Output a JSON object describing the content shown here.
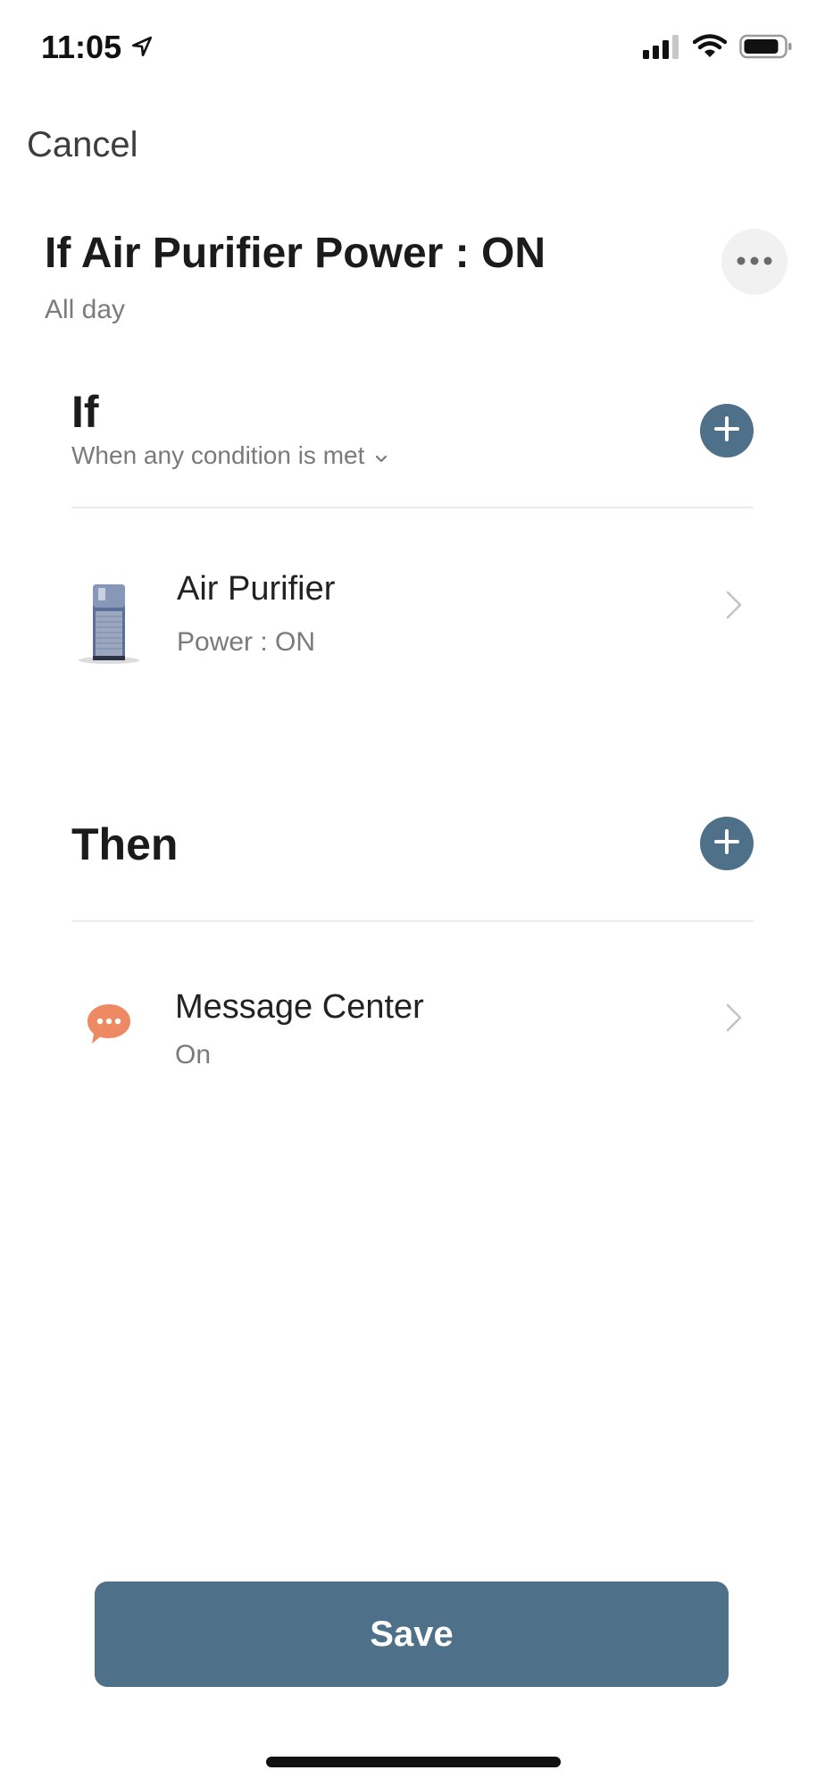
{
  "status_bar": {
    "time": "11:05",
    "icons": [
      "location-arrow-icon",
      "cellular-signal-icon",
      "wifi-icon",
      "battery-icon"
    ]
  },
  "nav": {
    "cancel_label": "Cancel"
  },
  "scene": {
    "title": "If Air Purifier Power : ON",
    "schedule": "All day",
    "more_icon": "more-horizontal-icon"
  },
  "if_section": {
    "title": "If",
    "condition_mode": "When any condition is met",
    "add_icon": "plus-icon",
    "conditions": [
      {
        "device": "Air Purifier",
        "state": "Power : ON",
        "icon": "air-purifier-icon"
      }
    ]
  },
  "then_section": {
    "title": "Then",
    "add_icon": "plus-icon",
    "actions": [
      {
        "name": "Message Center",
        "state": "On",
        "icon": "message-bubble-icon"
      }
    ]
  },
  "footer": {
    "save_label": "Save"
  },
  "colors": {
    "accent": "#4e7088",
    "message_icon": "#ee8a63",
    "muted_text": "#7a7a7a"
  }
}
